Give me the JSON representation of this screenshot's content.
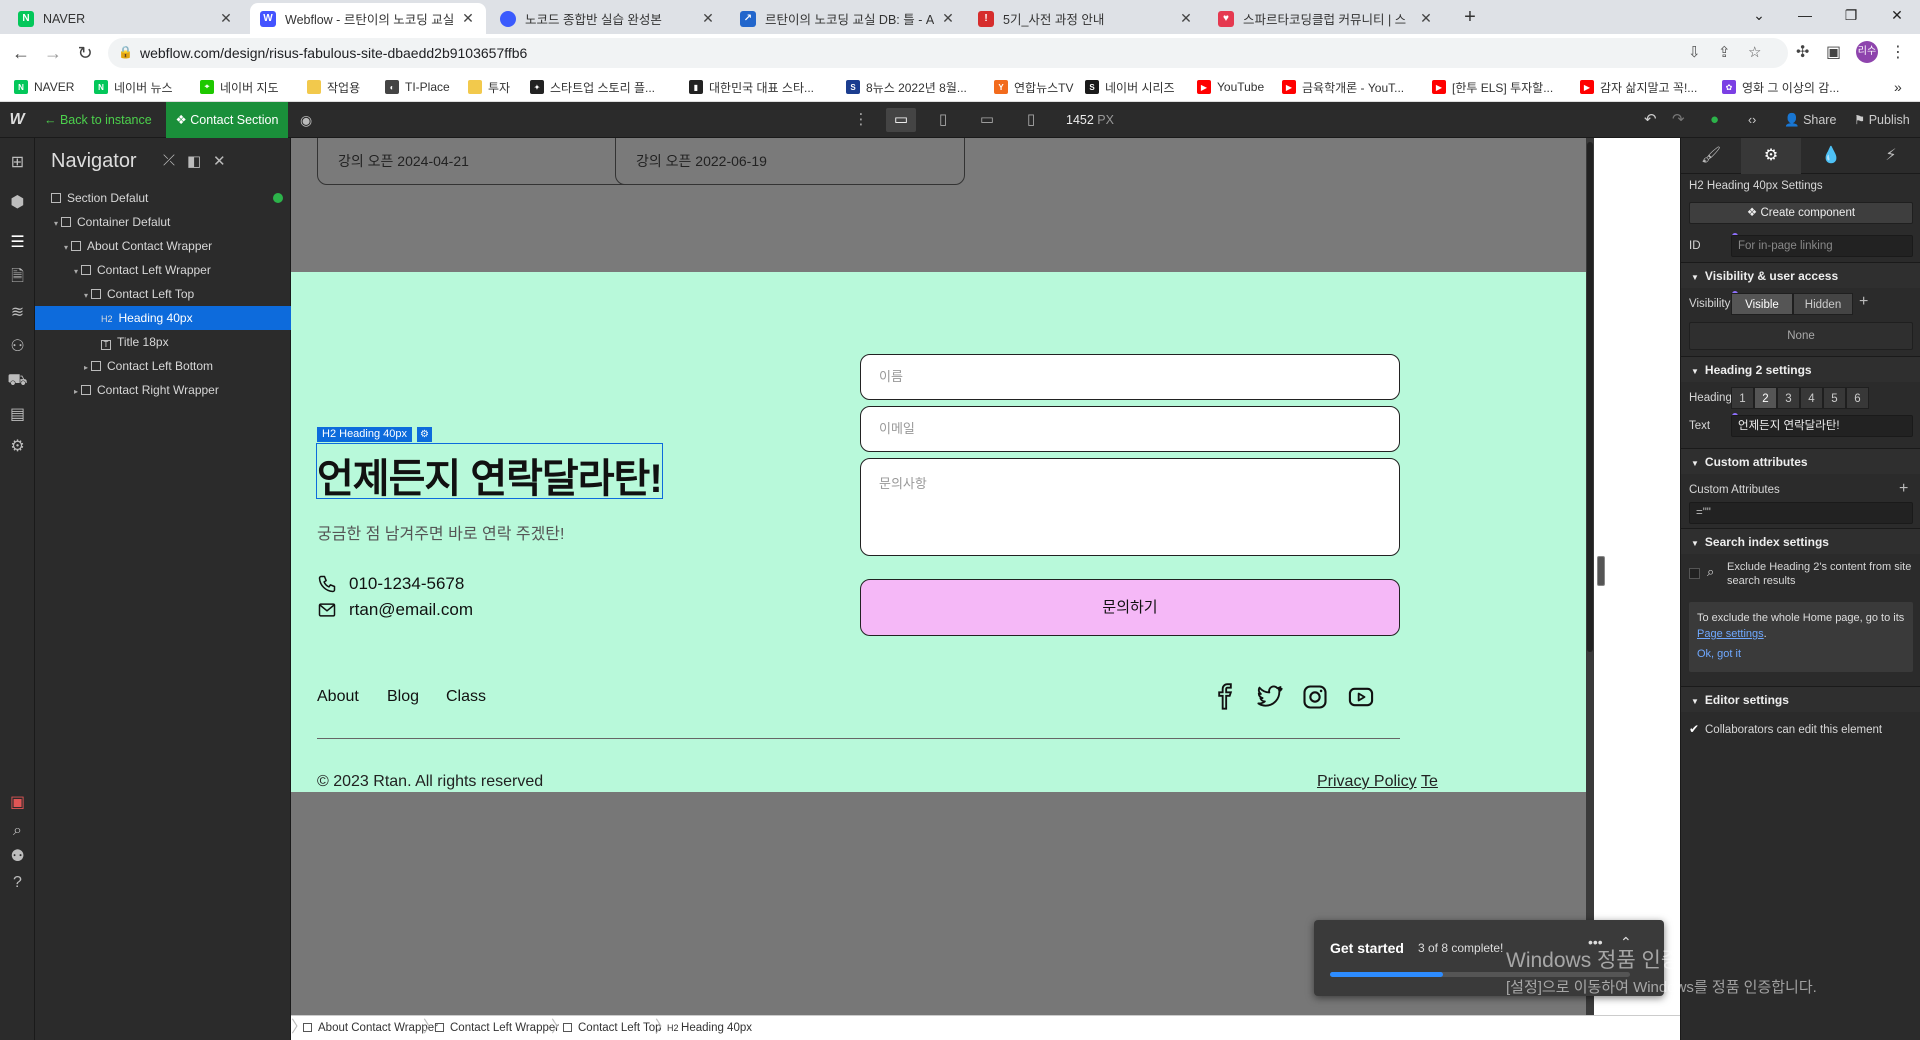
{
  "browser": {
    "tabs": [
      {
        "title": "NAVER",
        "icon": "naver-icon",
        "color": "#03c75a",
        "glyph": "N"
      },
      {
        "title": "Webflow - 르탄이의 노코딩 교실",
        "icon": "webflow-icon",
        "color": "#4353ff",
        "glyph": "W"
      },
      {
        "title": "노코드 종합반 실습 완성본",
        "icon": "circle-icon",
        "color": "#3b5bfd",
        "glyph": ""
      },
      {
        "title": "르탄이의 노코딩 교실 DB: 틀 - A",
        "icon": "link-icon",
        "color": "#2266cc",
        "glyph": "↗"
      },
      {
        "title": "5기_사전 과정 안내",
        "icon": "pin-icon",
        "color": "#d62d2d",
        "glyph": "!"
      },
      {
        "title": "스파르타코딩클럽 커뮤니티 | 스",
        "icon": "heart-icon",
        "color": "#e53950",
        "glyph": "♥"
      }
    ],
    "url": "webflow.com/design/risus-fabulous-site-dbaedd2b9103657ffb6",
    "profile_initials": "리수",
    "bookmarks": [
      {
        "label": "NAVER",
        "color": "#03c75a",
        "glyph": "N"
      },
      {
        "label": "네이버 뉴스",
        "color": "#03c75a",
        "glyph": "N"
      },
      {
        "label": "네이버 지도",
        "color": "#1ec800",
        "glyph": "⌖"
      },
      {
        "label": "작업용",
        "color": "#f2c94c",
        "glyph": ""
      },
      {
        "label": "TI-Place",
        "color": "#444444",
        "glyph": "◐"
      },
      {
        "label": "투자",
        "color": "#f2c94c",
        "glyph": ""
      },
      {
        "label": "스타트업 스토리 플...",
        "color": "#222222",
        "glyph": "✦"
      },
      {
        "label": "대한민국 대표 스타...",
        "color": "#222222",
        "glyph": "▮"
      },
      {
        "label": "8뉴스 2022년 8월...",
        "color": "#1b3d8f",
        "glyph": "S"
      },
      {
        "label": "연합뉴스TV",
        "color": "#f26b1d",
        "glyph": "Y"
      },
      {
        "label": "네이버 시리즈",
        "color": "#1a1a1a",
        "glyph": "S"
      },
      {
        "label": "YouTube",
        "color": "#ff0000",
        "glyph": "▶"
      },
      {
        "label": "금육학개론 - YouT...",
        "color": "#ff0000",
        "glyph": "▶"
      },
      {
        "label": "[한투 ELS] 투자할...",
        "color": "#ff0000",
        "glyph": "▶"
      },
      {
        "label": "감자 삶지말고 꼭!...",
        "color": "#ff0000",
        "glyph": "▶"
      },
      {
        "label": "영화 그 이상의 감...",
        "color": "#7b3fe4",
        "glyph": "✿"
      }
    ]
  },
  "webflow": {
    "back_instance": "← Back to instance",
    "component_chip": "Contact Section",
    "width_value": "1452",
    "width_unit": "PX",
    "share": "Share",
    "publish": "Publish"
  },
  "navigator": {
    "title": "Navigator",
    "tree": [
      {
        "label": "Section Defalut",
        "level": 0,
        "arrow": "",
        "kind": "box"
      },
      {
        "label": "Container Defalut",
        "level": 1,
        "arrow": "▾",
        "kind": "box"
      },
      {
        "label": "About Contact Wrapper",
        "level": 2,
        "arrow": "▾",
        "kind": "box"
      },
      {
        "label": "Contact  Left Wrapper",
        "level": 3,
        "arrow": "▾",
        "kind": "box"
      },
      {
        "label": "Contact Left Top",
        "level": 4,
        "arrow": "▾",
        "kind": "box"
      },
      {
        "label": "Heading 40px",
        "level": 5,
        "arrow": "",
        "kind": "h2",
        "selected": true
      },
      {
        "label": "Title 18px",
        "level": 5,
        "arrow": "",
        "kind": "text"
      },
      {
        "label": "Contact Left Bottom",
        "level": 4,
        "arrow": "▸",
        "kind": "box"
      },
      {
        "label": "Contact Right Wrapper",
        "level": 3,
        "arrow": "▸",
        "kind": "box"
      }
    ]
  },
  "canvas": {
    "course_cards": [
      "강의 오픈 2024-04-21",
      "강의 오픈 2022-06-19"
    ],
    "selection_label": "Heading 40px",
    "heading": "언제든지 연락달라탄!",
    "subtitle": "궁금한 점 남겨주면 바로 연락 주겠탄!",
    "phone": "010-1234-5678",
    "email": "rtan@email.com",
    "form": {
      "name_placeholder": "이름",
      "email_placeholder": "이메일",
      "message_placeholder": "문의사항",
      "submit": "문의하기"
    },
    "footer": {
      "links": [
        "About",
        "Blog",
        "Class"
      ],
      "copyright": "© 2023 Rtan. All rights reserved",
      "privacy": "Privacy Policy",
      "terms": "Te"
    },
    "colors": {
      "contact_bg": "#b8f9da",
      "submit_bg": "#f5b8f7"
    }
  },
  "breadcrumbs": [
    "About Contact Wrapper",
    "Contact  Left Wrapper",
    "Contact Left Top",
    "Heading 40px"
  ],
  "settings": {
    "element_title": "Heading 40px Settings",
    "create_component": "Create component",
    "id_label": "ID",
    "id_placeholder": "For in-page linking",
    "visibility_section": "Visibility & user access",
    "visibility_label": "Visibility",
    "visible": "Visible",
    "hidden": "Hidden",
    "none": "None",
    "heading_section": "Heading 2 settings",
    "heading_label": "Heading",
    "heading_levels": [
      "1",
      "2",
      "3",
      "4",
      "5",
      "6"
    ],
    "heading_selected": "2",
    "text_label": "Text",
    "text_value": "언제든지 연락달라탄!",
    "custom_section": "Custom attributes",
    "custom_label": "Custom Attributes",
    "custom_value": "=\"\"",
    "search_section": "Search index settings",
    "exclude_text": "Exclude Heading 2's content from site search results",
    "info_text_1": "To exclude the whole Home page, go to its",
    "info_link": "Page settings",
    "info_ok": "Ok, got it",
    "editor_section": "Editor settings",
    "collaborators": "Collaborators can edit this element"
  },
  "get_started": {
    "title": "Get started",
    "count": "3 of 8 complete!",
    "progress": 0.375
  },
  "watermark": {
    "line1": "Windows 정품 인증",
    "line2": "[설정]으로 이동하여 Windows를 정품 인증합니다."
  }
}
